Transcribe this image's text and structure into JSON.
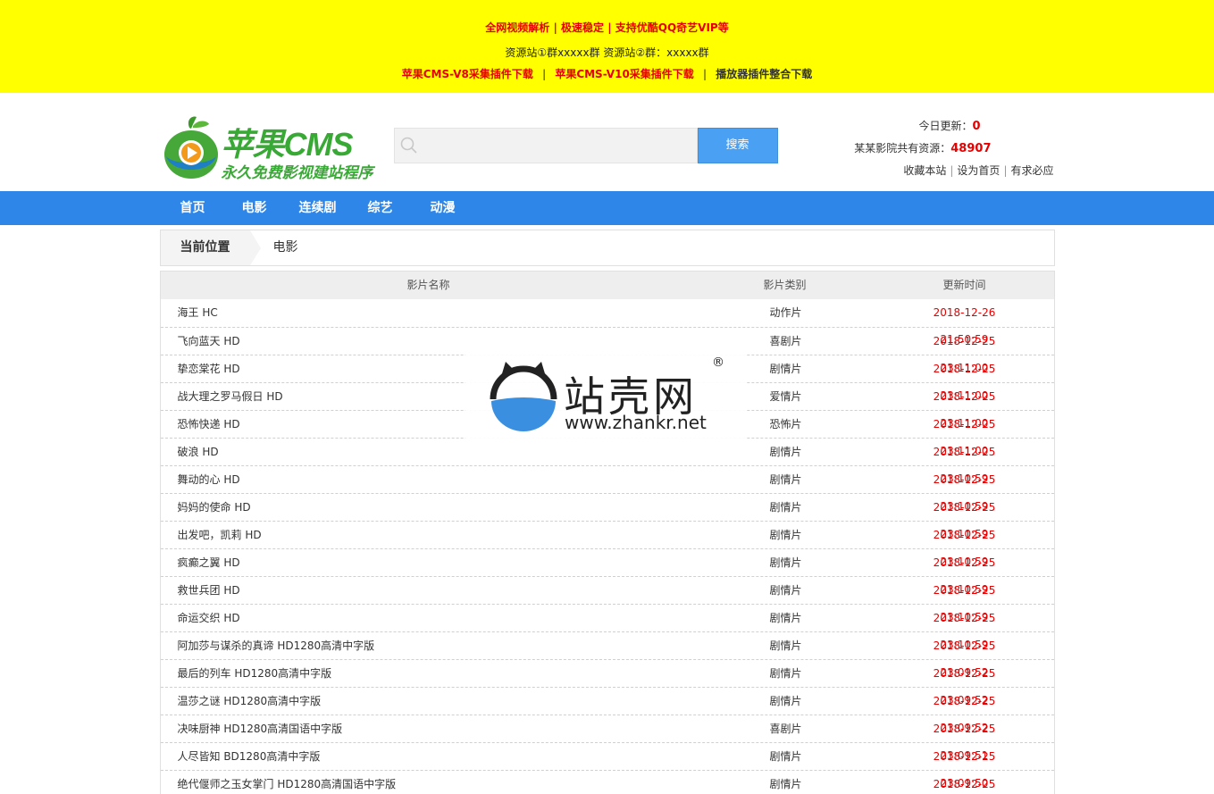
{
  "notice": {
    "line1": "全网视频解析 | 极速稳定 | 支持优酷QQ奇艺VIP等",
    "line2": "资源站①群xxxxx群 资源站②群：xxxxx群",
    "link1": "苹果CMS-V8采集插件下载",
    "link2": "苹果CMS-V10采集插件下载",
    "link3": "播放器插件整合下载",
    "separator": "|"
  },
  "logo": {
    "title": "苹果CMS",
    "slogan": "永久免费影视建站程序"
  },
  "search": {
    "placeholder": "",
    "button": "搜索"
  },
  "stats": {
    "today_label": "今日更新：",
    "today_value": "0",
    "total_label": "某某影院共有资源：",
    "total_value": "48907",
    "bookmark": "收藏本站",
    "set_home": "设为首页",
    "request": "有求必应",
    "pipe": "|"
  },
  "nav": {
    "items": [
      "首页",
      "电影",
      "连续剧",
      "综艺",
      "动漫"
    ]
  },
  "breadcrumb": {
    "label": "当前位置",
    "current": "电影"
  },
  "table": {
    "headers": [
      "影片名称",
      "影片类别",
      "更新时间"
    ],
    "rows": [
      {
        "name": "海王 HC",
        "category": "动作片",
        "time": "2018-12-26 21:50:59"
      },
      {
        "name": "飞向蓝天 HD",
        "category": "喜剧片",
        "time": "2018-12-25 23:11:00"
      },
      {
        "name": "挚恋棠花 HD",
        "category": "剧情片",
        "time": "2018-12-25 23:11:00"
      },
      {
        "name": "战大理之罗马假日 HD",
        "category": "爱情片",
        "time": "2018-12-25 23:11:00"
      },
      {
        "name": "恐怖快递 HD",
        "category": "恐怖片",
        "time": "2018-12-25 23:11:00"
      },
      {
        "name": "破浪 HD",
        "category": "剧情片",
        "time": "2018-12-25 23:10:59"
      },
      {
        "name": "舞动的心 HD",
        "category": "剧情片",
        "time": "2018-12-25 23:10:59"
      },
      {
        "name": "妈妈的使命 HD",
        "category": "剧情片",
        "time": "2018-12-25 23:10:59"
      },
      {
        "name": "出发吧，凯莉 HD",
        "category": "剧情片",
        "time": "2018-12-25 23:10:59"
      },
      {
        "name": "疯癫之翼 HD",
        "category": "剧情片",
        "time": "2018-12-25 23:10:59"
      },
      {
        "name": "救世兵团 HD",
        "category": "剧情片",
        "time": "2018-12-25 23:10:59"
      },
      {
        "name": "命运交织 HD",
        "category": "剧情片",
        "time": "2018-12-25 23:10:59"
      },
      {
        "name": "阿加莎与谋杀的真谛 HD1280高清中字版",
        "category": "剧情片",
        "time": "2018-12-25 23:09:52"
      },
      {
        "name": "最后的列车 HD1280高清中字版",
        "category": "剧情片",
        "time": "2018-12-25 23:09:52"
      },
      {
        "name": "温莎之谜 HD1280高清中字版",
        "category": "剧情片",
        "time": "2018-12-25 23:09:52"
      },
      {
        "name": "决味厨神 HD1280高清国语中字版",
        "category": "喜剧片",
        "time": "2018-12-25 23:09:51"
      },
      {
        "name": "人尽皆知 BD1280高清中字版",
        "category": "剧情片",
        "time": "2018-12-25 23:09:50"
      },
      {
        "name": "绝代偃师之玉女掌门 HD1280高清国语中字版",
        "category": "剧情片",
        "time": "2018-12-25 22:09:51"
      }
    ]
  },
  "watermark": {
    "title": "站壳网",
    "reg": "®",
    "url": "www.zhankr.net"
  },
  "colors": {
    "notice_bg": "#ffff00",
    "nav_bg": "#2e87e8",
    "accent_red": "#e60000",
    "search_button": "#4aa0f2",
    "logo_green": "#39a935"
  }
}
